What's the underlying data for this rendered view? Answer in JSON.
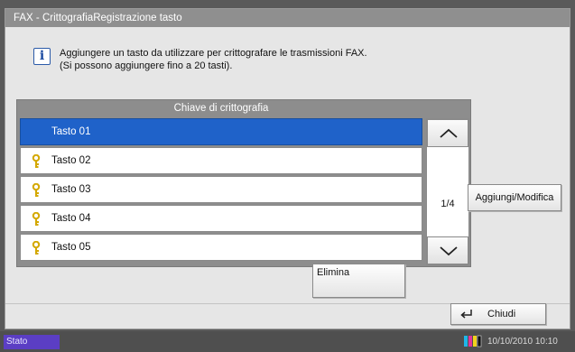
{
  "window": {
    "title": "FAX - CrittografiaRegistrazione tasto"
  },
  "message": {
    "line1": "Aggiungere un tasto da utilizzare per crittografare le trasmissioni FAX.",
    "line2": "(Si possono aggiungere fino a 20 tasti).",
    "icon": "info-icon",
    "icon_glyph": "i"
  },
  "list": {
    "header": "Chiave di crittografia",
    "rows": [
      {
        "label": "Tasto 01",
        "selected": true,
        "icon": "key-icon"
      },
      {
        "label": "Tasto 02",
        "selected": false,
        "icon": "key-icon"
      },
      {
        "label": "Tasto 03",
        "selected": false,
        "icon": "key-icon"
      },
      {
        "label": "Tasto 04",
        "selected": false,
        "icon": "key-icon"
      },
      {
        "label": "Tasto 05",
        "selected": false,
        "icon": "key-icon"
      }
    ],
    "page": "1/4"
  },
  "buttons": {
    "add_modify": "Aggiungi/Modifica",
    "delete": "Elimina",
    "close": "Chiudi"
  },
  "status": {
    "label": "Stato",
    "datetime": "10/10/2010  10:10"
  },
  "colors": {
    "selection": "#1f62c9",
    "status_label": "#5b3ec4",
    "key_icon": "#d4a800"
  }
}
